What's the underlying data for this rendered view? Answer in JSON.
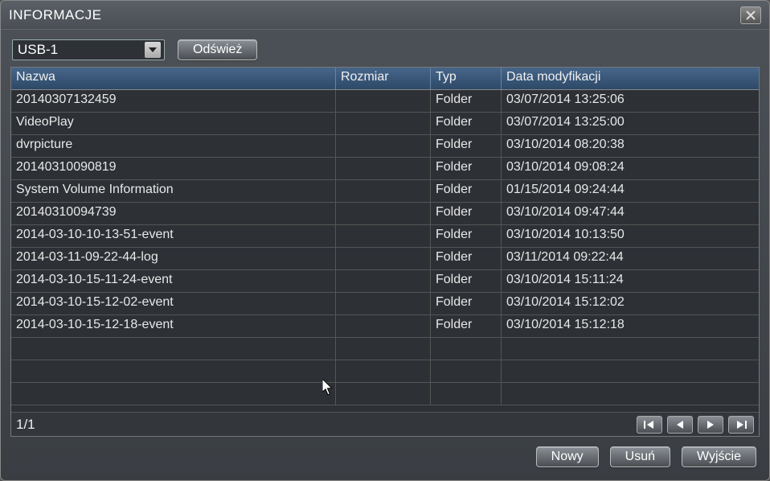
{
  "window": {
    "title": "INFORMACJE"
  },
  "toolbar": {
    "dropdown_value": "USB-1",
    "refresh_label": "Odśwież"
  },
  "table": {
    "headers": {
      "name": "Nazwa",
      "size": "Rozmiar",
      "type": "Typ",
      "date": "Data modyfikacji"
    },
    "rows": [
      {
        "name": "20140307132459",
        "size": "",
        "type": "Folder",
        "date": "03/07/2014 13:25:06"
      },
      {
        "name": "VideoPlay",
        "size": "",
        "type": "Folder",
        "date": "03/07/2014 13:25:00"
      },
      {
        "name": "dvrpicture",
        "size": "",
        "type": "Folder",
        "date": "03/10/2014 08:20:38"
      },
      {
        "name": "20140310090819",
        "size": "",
        "type": "Folder",
        "date": "03/10/2014 09:08:24"
      },
      {
        "name": "System Volume Information",
        "size": "",
        "type": "Folder",
        "date": "01/15/2014 09:24:44"
      },
      {
        "name": "20140310094739",
        "size": "",
        "type": "Folder",
        "date": "03/10/2014 09:47:44"
      },
      {
        "name": "2014-03-10-10-13-51-event",
        "size": "",
        "type": "Folder",
        "date": "03/10/2014 10:13:50"
      },
      {
        "name": "2014-03-11-09-22-44-log",
        "size": "",
        "type": "Folder",
        "date": "03/11/2014 09:22:44"
      },
      {
        "name": "2014-03-10-15-11-24-event",
        "size": "",
        "type": "Folder",
        "date": "03/10/2014 15:11:24"
      },
      {
        "name": "2014-03-10-15-12-02-event",
        "size": "",
        "type": "Folder",
        "date": "03/10/2014 15:12:02"
      },
      {
        "name": "2014-03-10-15-12-18-event",
        "size": "",
        "type": "Folder",
        "date": "03/10/2014 15:12:18"
      },
      {
        "name": "",
        "size": "",
        "type": "",
        "date": ""
      },
      {
        "name": "",
        "size": "",
        "type": "",
        "date": ""
      },
      {
        "name": "",
        "size": "",
        "type": "",
        "date": ""
      }
    ]
  },
  "footer": {
    "page": "1/1"
  },
  "buttons": {
    "new": "Nowy",
    "delete": "Usuń",
    "exit": "Wyjście"
  }
}
